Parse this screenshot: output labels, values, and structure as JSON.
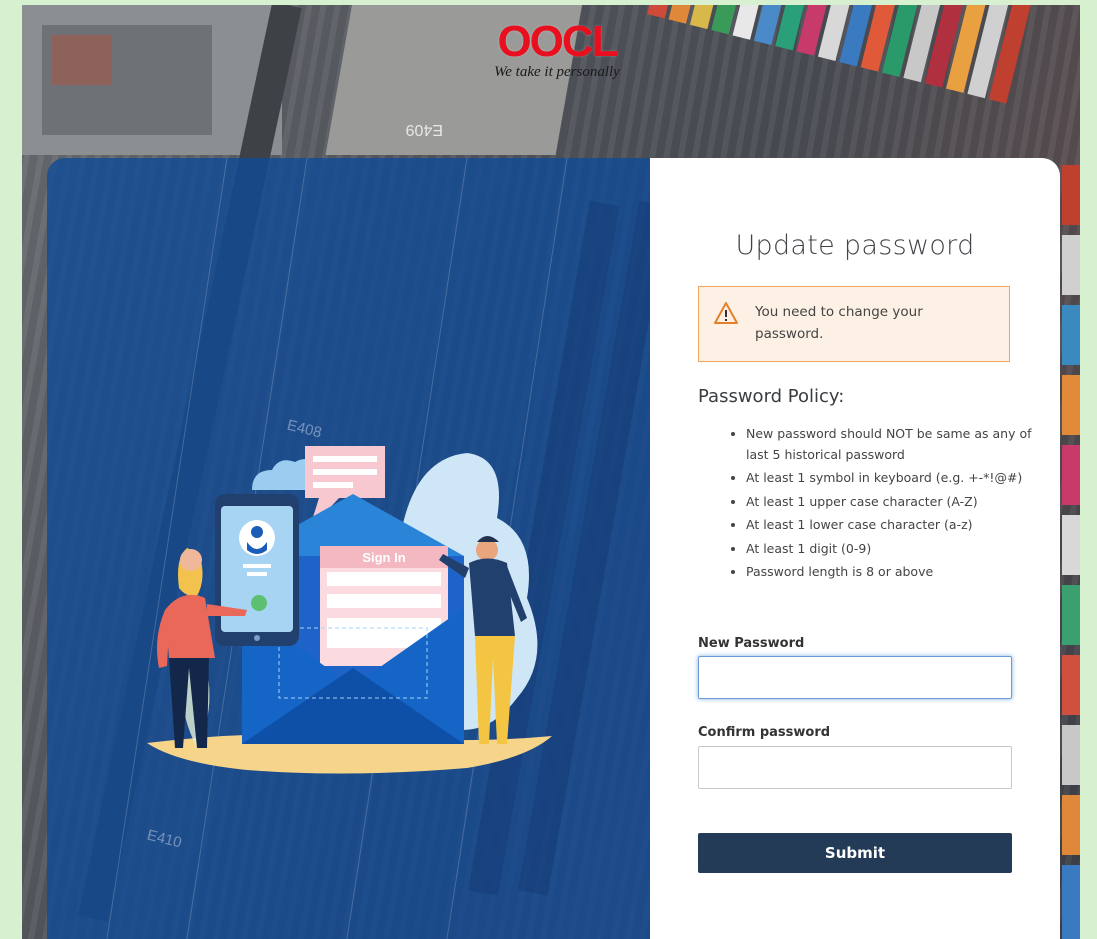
{
  "brand": {
    "logo_text": "OOCL",
    "tagline": "We take it personally",
    "logo_color": "#e8101e"
  },
  "illustration": {
    "sign_in_label": "Sign In",
    "ground_labels": [
      "E409",
      "E408",
      "E410"
    ]
  },
  "form": {
    "title": "Update password",
    "alert": {
      "icon": "warning-icon",
      "text": "You need to change your password."
    },
    "policy_title": "Password Policy:",
    "policy_items": [
      "New password should NOT be same as any of last 5 historical password",
      "At least 1 symbol in keyboard (e.g. +-*!@#)",
      "At least 1 upper case character (A-Z)",
      "At least 1 lower case character (a-z)",
      "At least 1 digit (0-9)",
      "Password length is 8 or above"
    ],
    "new_password_label": "New Password",
    "new_password_value": "",
    "confirm_password_label": "Confirm password",
    "confirm_password_value": "",
    "submit_label": "Submit"
  },
  "colors": {
    "page_bg": "#d6f0d0",
    "panel_blue": "#104a98",
    "button": "#243b57",
    "alert_bg": "#fdf1e6",
    "alert_border": "#f0a35a",
    "focus": "#6a9bd8"
  }
}
